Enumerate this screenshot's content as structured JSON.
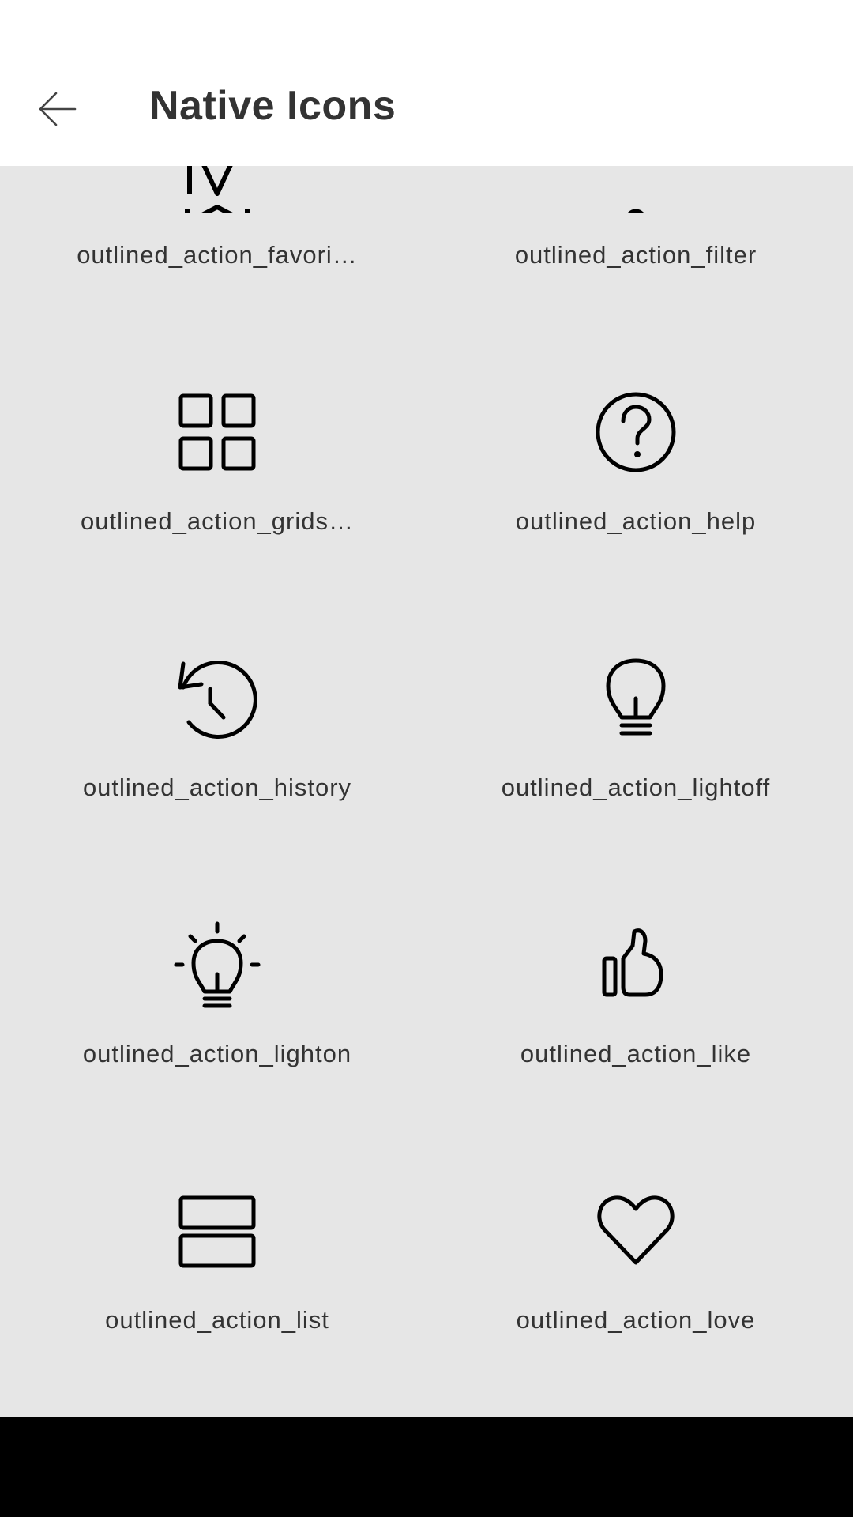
{
  "header": {
    "title": "Native Icons"
  },
  "icons": [
    {
      "label": "outlined_action_favori…",
      "icon": "favorite-icon"
    },
    {
      "label": "outlined_action_filter",
      "icon": "filter-icon"
    },
    {
      "label": "outlined_action_grids…",
      "icon": "grid-icon"
    },
    {
      "label": "outlined_action_help",
      "icon": "help-icon"
    },
    {
      "label": "outlined_action_history",
      "icon": "history-icon"
    },
    {
      "label": "outlined_action_lightoff",
      "icon": "lightbulb-off-icon"
    },
    {
      "label": "outlined_action_lighton",
      "icon": "lightbulb-on-icon"
    },
    {
      "label": "outlined_action_like",
      "icon": "thumbs-up-icon"
    },
    {
      "label": "outlined_action_list",
      "icon": "list-icon"
    },
    {
      "label": "outlined_action_love",
      "icon": "heart-icon"
    }
  ],
  "colors": {
    "background": "#e6e6e6",
    "app_bar": "#ffffff",
    "text": "#333333",
    "icon_stroke": "#000000",
    "nav_bar": "#000000"
  }
}
